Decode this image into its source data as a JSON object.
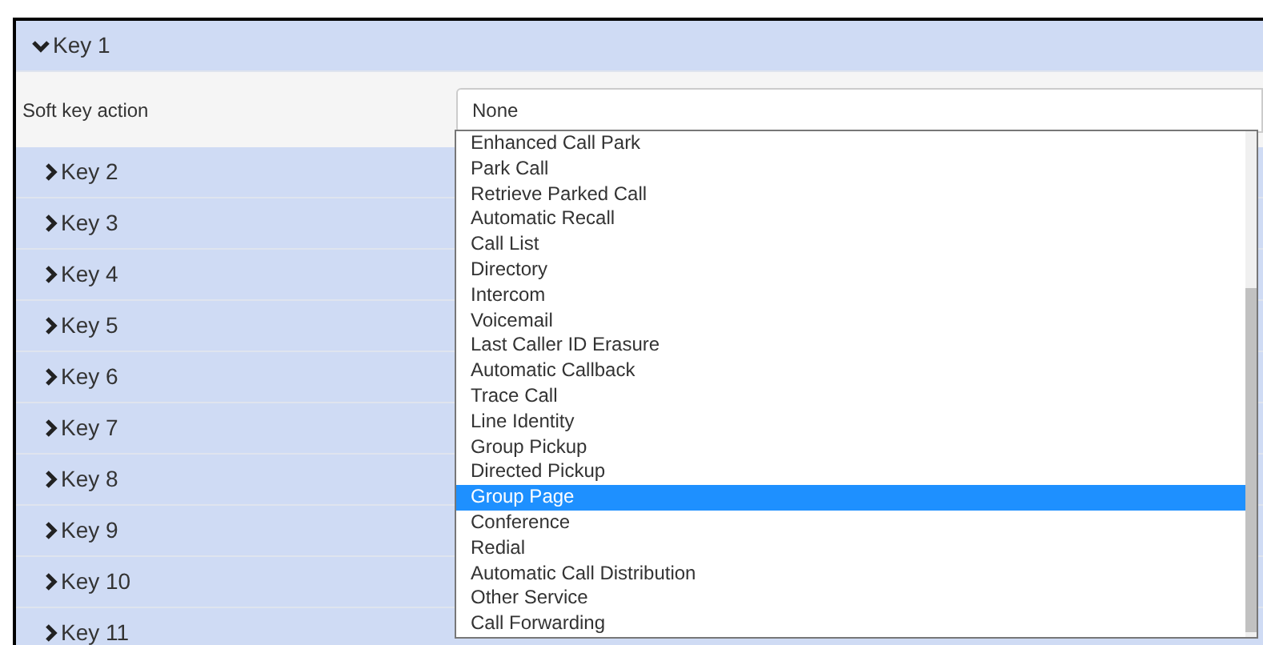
{
  "keys": [
    {
      "label": "Key 1",
      "expanded": true
    },
    {
      "label": "Key 2",
      "expanded": false
    },
    {
      "label": "Key 3",
      "expanded": false
    },
    {
      "label": "Key 4",
      "expanded": false
    },
    {
      "label": "Key 5",
      "expanded": false
    },
    {
      "label": "Key 6",
      "expanded": false
    },
    {
      "label": "Key 7",
      "expanded": false
    },
    {
      "label": "Key 8",
      "expanded": false
    },
    {
      "label": "Key 9",
      "expanded": false
    },
    {
      "label": "Key 10",
      "expanded": false
    },
    {
      "label": "Key 11",
      "expanded": false
    }
  ],
  "soft_key_action": {
    "label": "Soft key action",
    "value": "None",
    "options": [
      {
        "label": "Enhanced Call Park",
        "selected": false
      },
      {
        "label": "Park Call",
        "selected": false
      },
      {
        "label": "Retrieve Parked Call",
        "selected": false
      },
      {
        "label": "Automatic Recall",
        "selected": false
      },
      {
        "label": "Call List",
        "selected": false
      },
      {
        "label": "Directory",
        "selected": false
      },
      {
        "label": "Intercom",
        "selected": false
      },
      {
        "label": "Voicemail",
        "selected": false
      },
      {
        "label": "Last Caller ID Erasure",
        "selected": false
      },
      {
        "label": "Automatic Callback",
        "selected": false
      },
      {
        "label": "Trace Call",
        "selected": false
      },
      {
        "label": "Line Identity",
        "selected": false
      },
      {
        "label": "Group Pickup",
        "selected": false
      },
      {
        "label": "Directed Pickup",
        "selected": false
      },
      {
        "label": "Group Page",
        "selected": true
      },
      {
        "label": "Conference",
        "selected": false
      },
      {
        "label": "Redial",
        "selected": false
      },
      {
        "label": "Automatic Call Distribution",
        "selected": false
      },
      {
        "label": "Other Service",
        "selected": false
      },
      {
        "label": "Call Forwarding",
        "selected": false
      }
    ]
  }
}
